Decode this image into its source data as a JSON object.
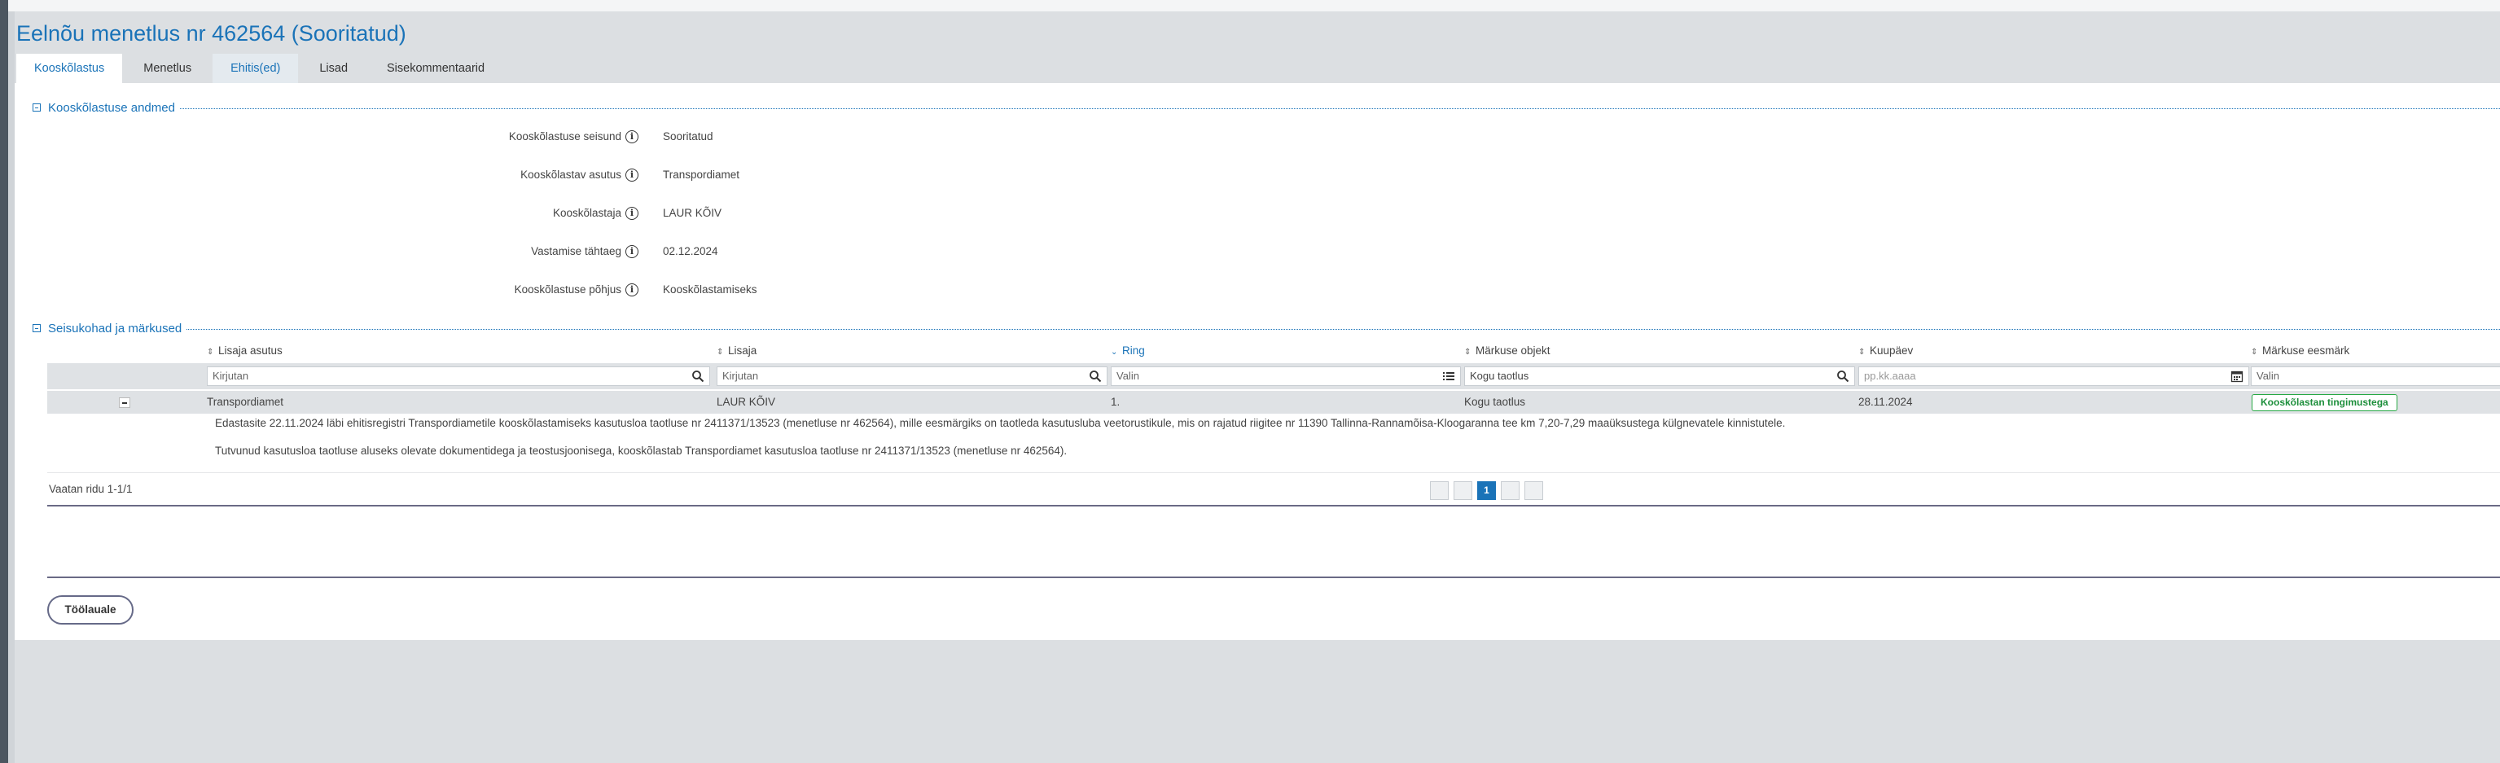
{
  "page": {
    "title": "Eelnõu menetlus nr 462564 (Sooritatud)"
  },
  "tabs": [
    {
      "label": "Kooskõlastus"
    },
    {
      "label": "Menetlus"
    },
    {
      "label": "Ehitis(ed)"
    },
    {
      "label": "Lisad"
    },
    {
      "label": "Sisekommentaarid"
    }
  ],
  "section1": {
    "title": "Kooskõlastuse andmed",
    "fields": [
      {
        "label": "Kooskõlastuse seisund",
        "value": "Sooritatud"
      },
      {
        "label": "Kooskõlastav asutus",
        "value": "Transpordiamet"
      },
      {
        "label": "Kooskõlastaja",
        "value": "LAUR KÕIV"
      },
      {
        "label": "Vastamise tähtaeg",
        "value": "02.12.2024"
      },
      {
        "label": "Kooskõlastuse põhjus",
        "value": "Kooskõlastamiseks"
      }
    ]
  },
  "section2": {
    "title": "Seisukohad ja märkused",
    "columns": [
      "Lisaja asutus",
      "Lisaja",
      "Ring",
      "Märkuse objekt",
      "Kuupäev",
      "Märkuse eesmärk"
    ],
    "filters": [
      "Kirjutan",
      "Kirjutan",
      "Valin",
      "Kogu taotlus",
      "pp.kk.aaaa",
      "Valin"
    ],
    "row": {
      "asutus": "Transpordiamet",
      "lisaja": "LAUR KÕIV",
      "ring": "1.",
      "objekt": "Kogu taotlus",
      "kuupaev": "28.11.2024",
      "eesmark": "Kooskõlastan tingimustega"
    },
    "details": [
      "Edastasite 22.11.2024 läbi ehitisregistri Transpordiametile kooskõlastamiseks kasutusloa taotluse nr 2411371/13523 (menetluse nr 462564), mille eesmärgiks on taotleda kasutusluba veetorustikule, mis on rajatud riigitee nr 11390 Tallinna-Rannamõisa-Kloogaranna tee km 7,20-7,29 maaüksustega külgnevatele kinnistutele.",
      "Tutvunud kasutusloa taotluse aluseks olevate dokumentidega ja teostusjoonisega, kooskõlastab Transpordiamet kasutusloa taotluse nr 2411371/13523 (menetluse nr 462564)."
    ],
    "footer_count": "Vaatan ridu 1-1/1",
    "current_page": "1"
  },
  "button_label": "Töölauale",
  "colors": {
    "accent": "#1a73b8",
    "badge": "#27a844"
  },
  "icons": [
    "search-icon",
    "list-icon",
    "calendar-icon",
    "info-icon",
    "sort-icon",
    "collapse-icon"
  ]
}
